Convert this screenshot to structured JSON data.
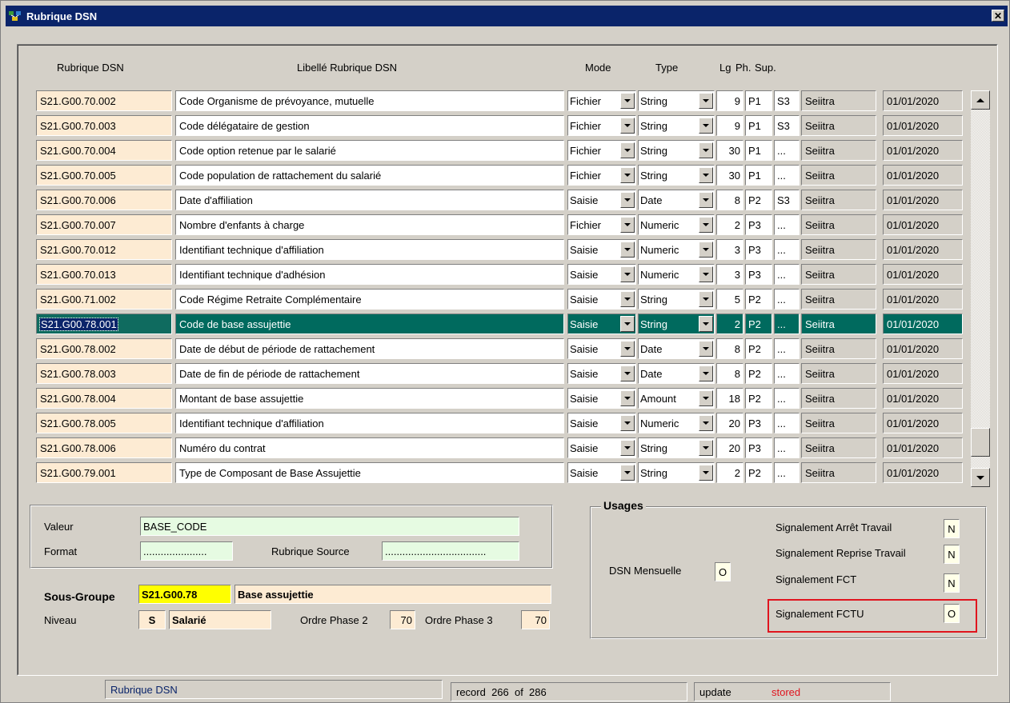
{
  "window": {
    "title": "Rubrique DSN",
    "close_glyph": "✕"
  },
  "headers": {
    "rubrique": "Rubrique DSN",
    "libelle": "Libellé Rubrique DSN",
    "mode": "Mode",
    "type": "Type",
    "lg": "Lg",
    "ph": "Ph.",
    "sup": "Sup."
  },
  "rows": [
    {
      "code": "S21.G00.70.002",
      "libelle": "Code Organisme de prévoyance, mutuelle",
      "mode": "Fichier",
      "type": "String",
      "lg": "9",
      "ph": "P1",
      "sup": "S3",
      "src": "Seiitra",
      "date": "01/01/2020"
    },
    {
      "code": "S21.G00.70.003",
      "libelle": "Code délégataire de gestion",
      "mode": "Fichier",
      "type": "String",
      "lg": "9",
      "ph": "P1",
      "sup": "S3",
      "src": "Seiitra",
      "date": "01/01/2020"
    },
    {
      "code": "S21.G00.70.004",
      "libelle": "Code option retenue par le salarié",
      "mode": "Fichier",
      "type": "String",
      "lg": "30",
      "ph": "P1",
      "sup": "...",
      "src": "Seiitra",
      "date": "01/01/2020"
    },
    {
      "code": "S21.G00.70.005",
      "libelle": "Code population de rattachement du salarié",
      "mode": "Fichier",
      "type": "String",
      "lg": "30",
      "ph": "P1",
      "sup": "...",
      "src": "Seiitra",
      "date": "01/01/2020"
    },
    {
      "code": "S21.G00.70.006",
      "libelle": "Date d'affiliation",
      "mode": "Saisie",
      "type": "Date",
      "lg": "8",
      "ph": "P2",
      "sup": "S3",
      "src": "Seiitra",
      "date": "01/01/2020"
    },
    {
      "code": "S21.G00.70.007",
      "libelle": "Nombre d'enfants à charge",
      "mode": "Fichier",
      "type": "Numeric",
      "lg": "2",
      "ph": "P3",
      "sup": "...",
      "src": "Seiitra",
      "date": "01/01/2020"
    },
    {
      "code": "S21.G00.70.012",
      "libelle": "Identifiant technique d'affiliation",
      "mode": "Saisie",
      "type": "Numeric",
      "lg": "3",
      "ph": "P3",
      "sup": "...",
      "src": "Seiitra",
      "date": "01/01/2020"
    },
    {
      "code": "S21.G00.70.013",
      "libelle": "Identifiant technique d'adhésion",
      "mode": "Saisie",
      "type": "Numeric",
      "lg": "3",
      "ph": "P3",
      "sup": "...",
      "src": "Seiitra",
      "date": "01/01/2020"
    },
    {
      "code": "S21.G00.71.002",
      "libelle": "Code Régime Retraite Complémentaire",
      "mode": "Saisie",
      "type": "String",
      "lg": "5",
      "ph": "P2",
      "sup": "...",
      "src": "Seiitra",
      "date": "01/01/2020"
    },
    {
      "code": "S21.G00.78.001",
      "libelle": "Code de base assujettie",
      "mode": "Saisie",
      "type": "String",
      "lg": "2",
      "ph": "P2",
      "sup": "...",
      "src": "Seiitra",
      "date": "01/01/2020",
      "selected": true
    },
    {
      "code": "S21.G00.78.002",
      "libelle": "Date de début de période de rattachement",
      "mode": "Saisie",
      "type": "Date",
      "lg": "8",
      "ph": "P2",
      "sup": "...",
      "src": "Seiitra",
      "date": "01/01/2020"
    },
    {
      "code": "S21.G00.78.003",
      "libelle": "Date de fin de période de rattachement",
      "mode": "Saisie",
      "type": "Date",
      "lg": "8",
      "ph": "P2",
      "sup": "...",
      "src": "Seiitra",
      "date": "01/01/2020"
    },
    {
      "code": "S21.G00.78.004",
      "libelle": "Montant de base assujettie",
      "mode": "Saisie",
      "type": "Amount",
      "lg": "18",
      "ph": "P2",
      "sup": "...",
      "src": "Seiitra",
      "date": "01/01/2020"
    },
    {
      "code": "S21.G00.78.005",
      "libelle": "Identifiant technique d'affiliation",
      "mode": "Saisie",
      "type": "Numeric",
      "lg": "20",
      "ph": "P3",
      "sup": "...",
      "src": "Seiitra",
      "date": "01/01/2020"
    },
    {
      "code": "S21.G00.78.006",
      "libelle": "Numéro du contrat",
      "mode": "Saisie",
      "type": "String",
      "lg": "20",
      "ph": "P3",
      "sup": "...",
      "src": "Seiitra",
      "date": "01/01/2020"
    },
    {
      "code": "S21.G00.79.001",
      "libelle": "Type de Composant de Base Assujettie",
      "mode": "Saisie",
      "type": "String",
      "lg": "2",
      "ph": "P2",
      "sup": "...",
      "src": "Seiitra",
      "date": "01/01/2020"
    }
  ],
  "details": {
    "valeur_label": "Valeur",
    "valeur_value": "BASE_CODE",
    "format_label": "Format",
    "format_value": "......................",
    "rubrique_source_label": "Rubrique Source",
    "rubrique_source_value": "..................................."
  },
  "sous_groupe": {
    "label": "Sous-Groupe",
    "code": "S21.G00.78",
    "name": "Base assujettie",
    "niveau_label": "Niveau",
    "niveau_code": "S",
    "niveau_name": "Salarié",
    "ordre2_label": "Ordre Phase 2",
    "ordre2_value": "70",
    "ordre3_label": "Ordre Phase 3",
    "ordre3_value": "70"
  },
  "usages": {
    "title": "Usages",
    "dsn_mensuelle_label": "DSN Mensuelle",
    "dsn_mensuelle_value": "O",
    "arret_label": "Signalement Arrêt Travail",
    "arret_value": "N",
    "reprise_label": "Signalement Reprise Travail",
    "reprise_value": "N",
    "fct_label": "Signalement FCT",
    "fct_value": "N",
    "fctu_label": "Signalement FCTU",
    "fctu_value": "O"
  },
  "status": {
    "form_name": "Rubrique DSN",
    "record_text": "record  266  of  286",
    "mode_text": "update",
    "state_text": "stored",
    "state_color": "#e0141e",
    "form_name_color": "#0a246a"
  },
  "colors": {
    "title_bar": "#0a246a",
    "selected_row": "#006a5e",
    "code_cell": "#fdebd3",
    "highlight_box": "#e0141e"
  }
}
